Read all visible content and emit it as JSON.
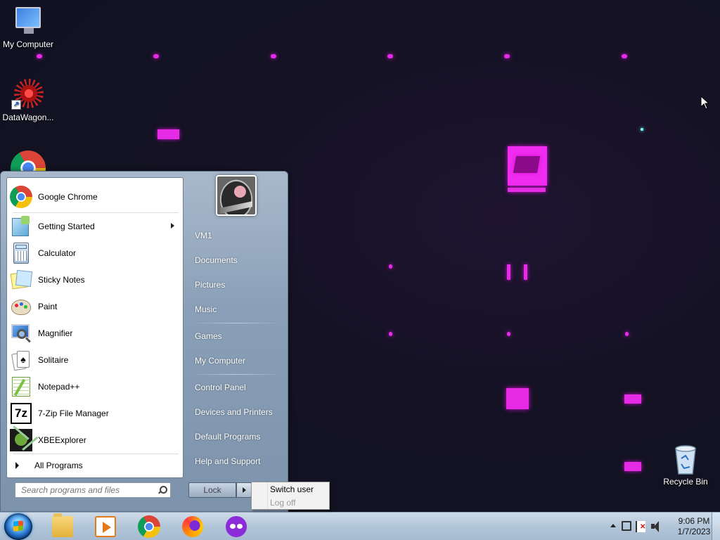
{
  "desktop": {
    "icons": [
      {
        "label": "My Computer",
        "icon": "computer-icon"
      },
      {
        "label": "DataWagon...",
        "icon": "datawagon-icon"
      },
      {
        "label": "",
        "icon": "chrome-icon"
      },
      {
        "label": "Recycle Bin",
        "icon": "recycle-bin-icon"
      }
    ]
  },
  "start_menu": {
    "programs": [
      {
        "label": "Google Chrome",
        "icon": "chrome-icon"
      },
      {
        "label": "Getting Started",
        "icon": "getting-started-icon",
        "has_submenu": true
      },
      {
        "label": "Calculator",
        "icon": "calculator-icon"
      },
      {
        "label": "Sticky Notes",
        "icon": "sticky-notes-icon"
      },
      {
        "label": "Paint",
        "icon": "paint-icon"
      },
      {
        "label": "Magnifier",
        "icon": "magnifier-icon"
      },
      {
        "label": "Solitaire",
        "icon": "solitaire-icon"
      },
      {
        "label": "Notepad++",
        "icon": "notepadpp-icon"
      },
      {
        "label": "7-Zip File Manager",
        "icon": "7zip-icon"
      },
      {
        "label": "XBEExplorer",
        "icon": "xbeexplorer-icon"
      }
    ],
    "all_programs": "All Programs",
    "search_placeholder": "Search programs and files",
    "right_items": {
      "user": "VM1",
      "documents": "Documents",
      "pictures": "Pictures",
      "music": "Music",
      "games": "Games",
      "my_computer": "My Computer",
      "control_panel": "Control Panel",
      "devices": "Devices and Printers",
      "default_programs": "Default Programs",
      "help": "Help and Support"
    },
    "lock_label": "Lock",
    "flyout": {
      "switch_user": "Switch user",
      "log_off": "Log off"
    }
  },
  "taskbar": {
    "pinned": [
      "folder-icon",
      "media-player-icon",
      "chrome-icon",
      "firefox-icon",
      "mask-app-icon"
    ],
    "clock": {
      "time": "9:06 PM",
      "date": "1/7/2023"
    }
  },
  "colors": {
    "wallpaper_accent": "#e62be6",
    "start_menu_bg": "#8aa0b8",
    "taskbar_bg": "#b2c6da"
  }
}
